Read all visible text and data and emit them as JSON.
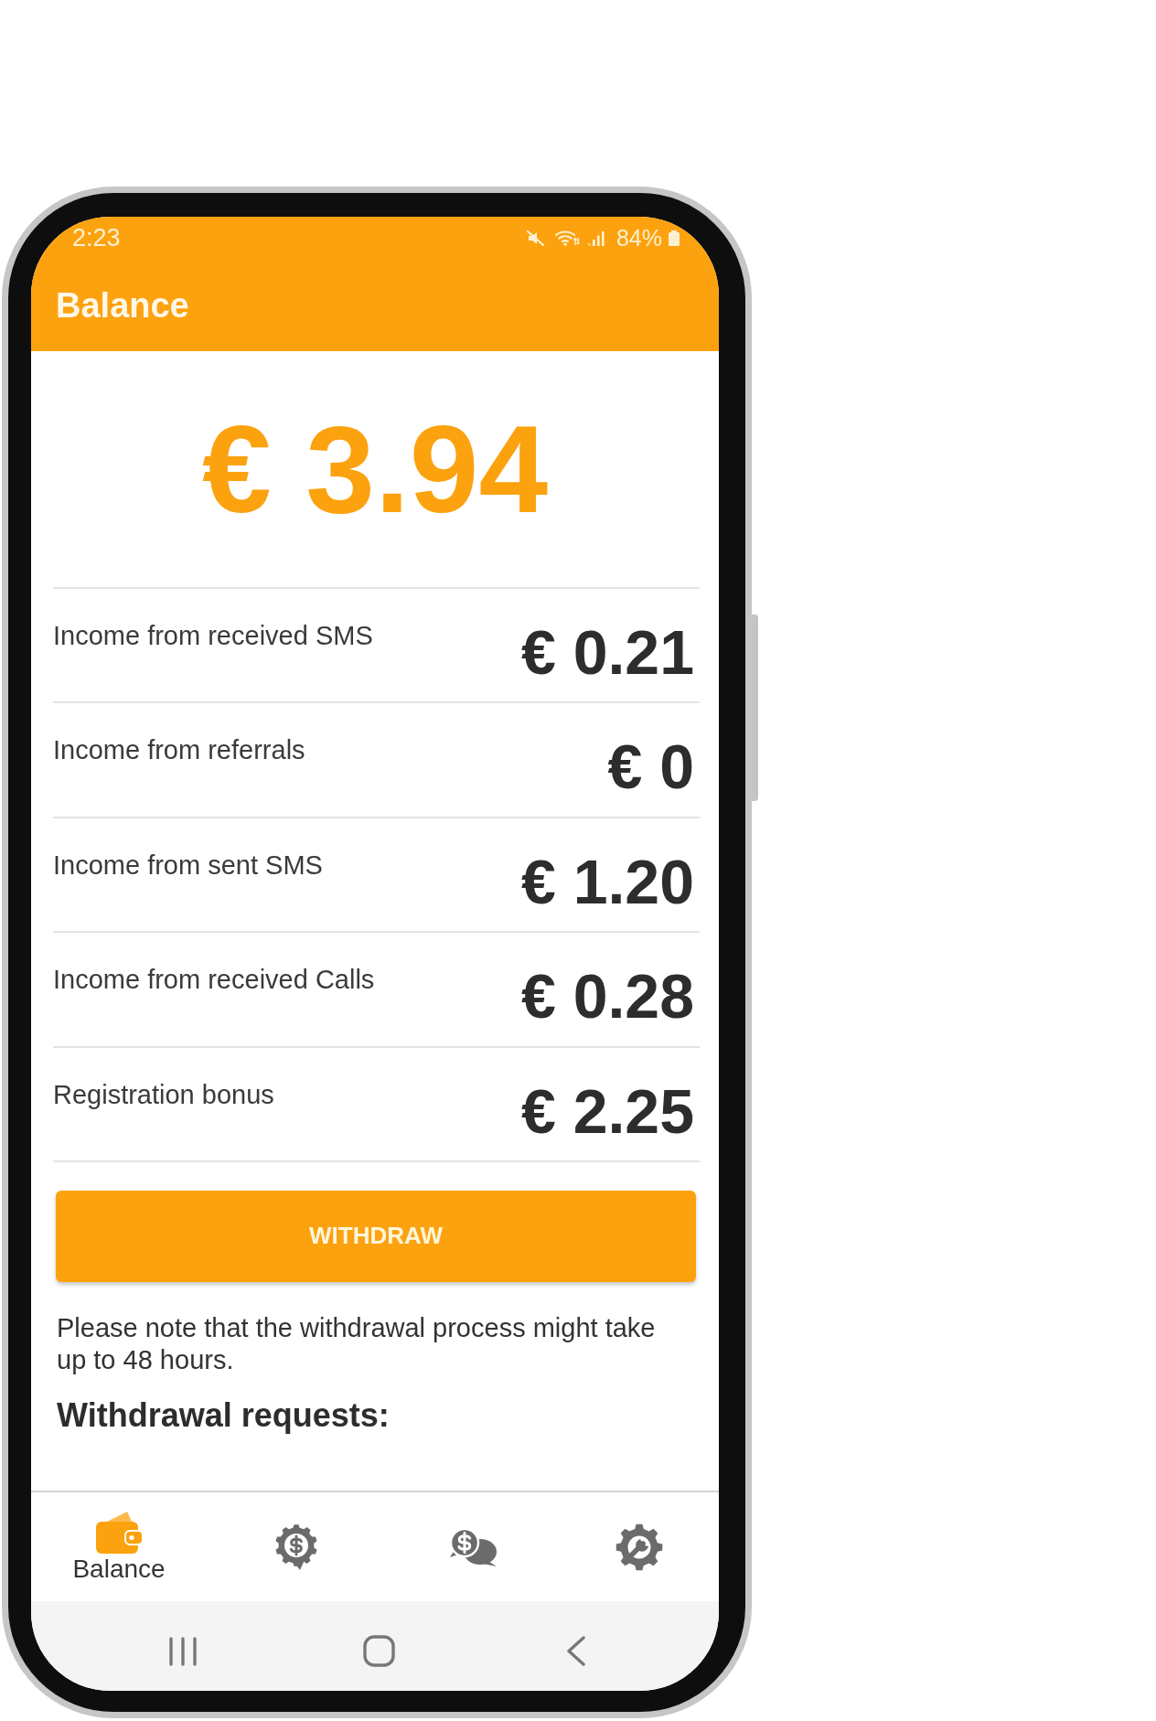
{
  "status_bar": {
    "time": "2:23",
    "battery": "84%"
  },
  "app_bar": {
    "title": "Balance"
  },
  "balance": {
    "amount": "€ 3.94"
  },
  "income_rows": [
    {
      "label": "Income from received SMS",
      "value": "€ 0.21"
    },
    {
      "label": "Income from referrals",
      "value": "€ 0"
    },
    {
      "label": "Income from sent SMS",
      "value": "€ 1.20"
    },
    {
      "label": "Income from received Calls",
      "value": "€ 0.28"
    },
    {
      "label": "Registration bonus",
      "value": "€ 2.25"
    }
  ],
  "withdraw_button": {
    "label": "WITHDRAW"
  },
  "note": "Please note that the withdrawal process might take up to 48 hours.",
  "withdrawal_requests": {
    "heading": "Withdrawal requests:"
  },
  "bottom_nav": [
    {
      "label": "Balance",
      "selected": true
    },
    {
      "selected": false
    },
    {
      "selected": false
    },
    {
      "selected": false
    }
  ]
}
